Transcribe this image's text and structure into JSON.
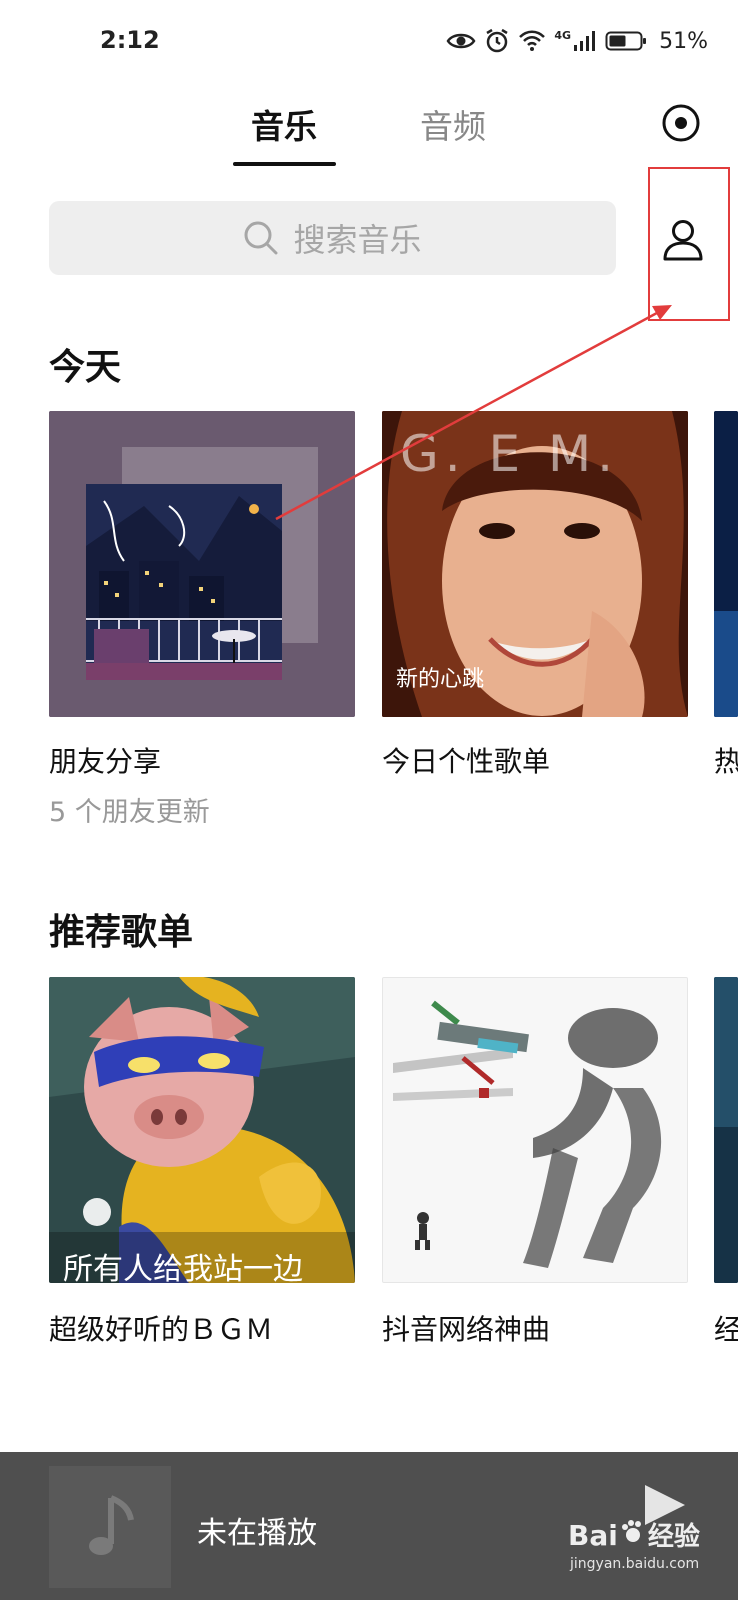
{
  "status_bar": {
    "time": "2:12",
    "network": "4G",
    "battery": "51%"
  },
  "tabs": {
    "active": "音乐",
    "inactive": "音频"
  },
  "search": {
    "placeholder": "搜索音乐"
  },
  "today": {
    "title": "今天",
    "cards": [
      {
        "title": "朋友分享",
        "subtitle": "5 个朋友更新"
      },
      {
        "title": "今日个性歌单",
        "cover_text": "G.  E  M.",
        "cover_caption": "新的心跳"
      },
      {
        "title": "热"
      }
    ]
  },
  "recommended": {
    "title": "推荐歌单",
    "cards": [
      {
        "title": "超级好听的ＢＧＭ",
        "cover_caption": "所有人给我站一边"
      },
      {
        "title": "抖音网络神曲"
      },
      {
        "title": "经"
      }
    ]
  },
  "player": {
    "status": "未在播放"
  },
  "watermark": {
    "brand": "Bai",
    "brand2": "经验",
    "url": "jingyan.baidu.com"
  },
  "colors": {
    "accent_annotation": "#e23c3c",
    "player_bg": "#4f4f4f",
    "search_bg": "#eeeeee"
  }
}
